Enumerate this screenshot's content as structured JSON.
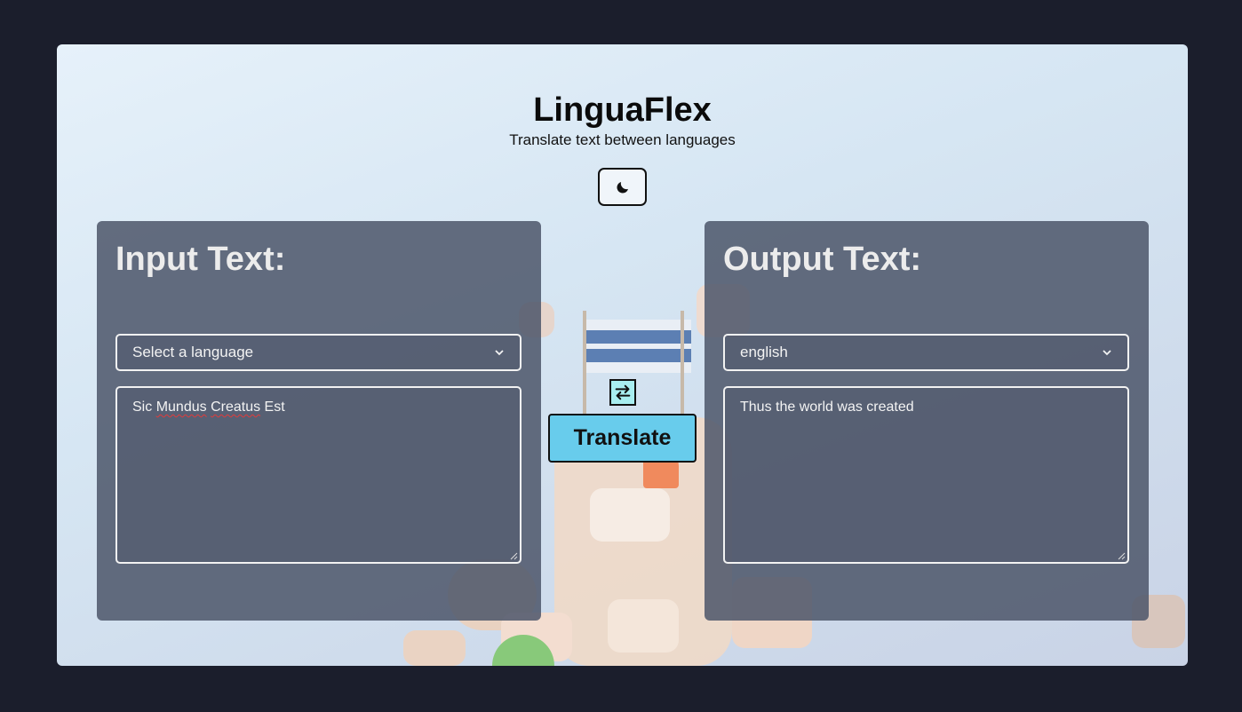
{
  "app": {
    "title": "LinguaFlex",
    "subtitle": "Translate text between languages"
  },
  "theme_toggle": {
    "icon": "moon-icon"
  },
  "input_panel": {
    "heading": "Input Text:",
    "language_select": "Select a language",
    "text_words": [
      "Sic",
      "Mundus",
      "Creatus",
      "Est"
    ]
  },
  "output_panel": {
    "heading": "Output Text:",
    "language_select": "english",
    "text": "Thus the world was created"
  },
  "swap_button": {
    "icon": "swap-arrows-icon"
  },
  "translate_button": {
    "label": "Translate"
  },
  "colors": {
    "page_background": "#1b1e2c",
    "panel": "#4d566a",
    "translate_button": "#68ccec",
    "swap_button": "#a8eef0"
  }
}
